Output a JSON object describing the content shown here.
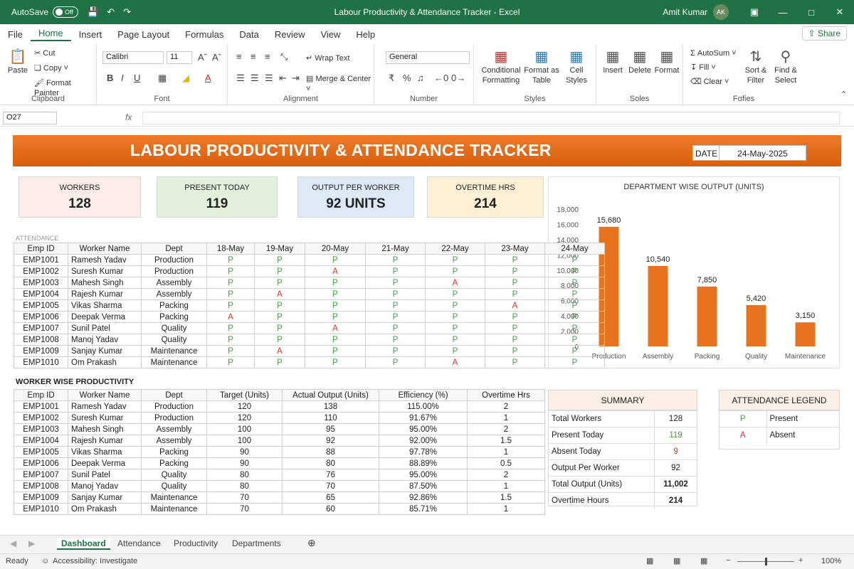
{
  "titlebar": {
    "autosave_label": "AutoSave",
    "autosave_state": "Off",
    "doc_title": "Labour Productivity & Attendance Tracker  -  Excel",
    "user_name": "Amit Kumar",
    "user_initials": "AK"
  },
  "menu": {
    "tabs": [
      "File",
      "Home",
      "Insert",
      "Page Layout",
      "Formulas",
      "Data",
      "Review",
      "View",
      "Help"
    ],
    "share_label": "Share"
  },
  "ribbon": {
    "clipboard": {
      "paste": "Paste",
      "cut": "Cut",
      "copy": "Copy",
      "format_painter": "Format Painter",
      "label": "Clipboard"
    },
    "font": {
      "name": "Calibri",
      "size": "11",
      "label": "Font"
    },
    "alignment": {
      "wrap": "Wrap Text",
      "merge": "Merge & Center",
      "label": "Alignment"
    },
    "number": {
      "format": "General",
      "label": "Number"
    },
    "styles": {
      "conditional": "Conditional Formatting",
      "format_table": "Format as Table",
      "cell_styles": "Cell Styles",
      "label": "Styles"
    },
    "cells": {
      "insert": "Insert",
      "delete": "Delete",
      "format": "Format",
      "label": "Ѕоlеs"
    },
    "editing": {
      "autosum": "AutoSum",
      "fill": "Fill",
      "clear": "Clear",
      "sort": "Sort & Filter",
      "find": "Find & Select",
      "label": "Fαfίes"
    }
  },
  "formula_bar": {
    "name_box": "O27",
    "fx": "fx"
  },
  "dashboard": {
    "title": "LABOUR PRODUCTIVITY & ATTENDANCE TRACKER",
    "date_label": "DATE",
    "date_value": "24-May-2025",
    "kpis": [
      {
        "label": "WORKERS",
        "value": "128",
        "bg": "#fbece7"
      },
      {
        "label": "PRESENT TODAY",
        "value": "119",
        "bg": "#e3f1db"
      },
      {
        "label": "OUTPUT PER WORKER",
        "value": "92 UNITS",
        "bg": "#dde9f5"
      },
      {
        "label": "OVERTIME HRS",
        "value": "214",
        "bg": "#fdf0d5"
      }
    ]
  },
  "attendance": {
    "section_label": "ATTENDANCE",
    "headers": [
      "Emp ID",
      "Worker Name",
      "Dept",
      "18-May",
      "19-May",
      "20-May",
      "21-May",
      "22-May",
      "23-May",
      "24-May"
    ],
    "rows": [
      [
        "EMP1001",
        "Ramesh Yadav",
        "Production",
        "P",
        "P",
        "P",
        "P",
        "P",
        "P",
        "P"
      ],
      [
        "EMP1002",
        "Suresh Kumar",
        "Production",
        "P",
        "P",
        "A",
        "P",
        "P",
        "P",
        "P"
      ],
      [
        "EMP1003",
        "Mahesh Singh",
        "Assembly",
        "P",
        "P",
        "P",
        "P",
        "A",
        "P",
        "P"
      ],
      [
        "EMP1004",
        "Rajesh Kumar",
        "Assembly",
        "P",
        "A",
        "P",
        "P",
        "P",
        "P",
        "P"
      ],
      [
        "EMP1005",
        "Vikas Sharma",
        "Packing",
        "P",
        "P",
        "P",
        "P",
        "P",
        "A",
        "P"
      ],
      [
        "EMP1006",
        "Deepak Verma",
        "Packing",
        "A",
        "P",
        "P",
        "P",
        "P",
        "P",
        "P"
      ],
      [
        "EMP1007",
        "Sunil Patel",
        "Quality",
        "P",
        "P",
        "A",
        "P",
        "P",
        "P",
        "P"
      ],
      [
        "EMP1008",
        "Manoj Yadav",
        "Quality",
        "P",
        "P",
        "P",
        "P",
        "P",
        "P",
        "P"
      ],
      [
        "EMP1009",
        "Sanjay Kumar",
        "Maintenance",
        "P",
        "A",
        "P",
        "P",
        "P",
        "P",
        "P"
      ],
      [
        "EMP1010",
        "Om Prakash",
        "Maintenance",
        "P",
        "P",
        "P",
        "P",
        "A",
        "P",
        "P"
      ]
    ]
  },
  "productivity": {
    "section_label": "WORKER WISE PRODUCTIVITY",
    "headers": [
      "Emp ID",
      "Worker Name",
      "Dept",
      "Target (Units)",
      "Actual Output (Units)",
      "Efficiency (%)",
      "Overtime Hrs"
    ],
    "rows": [
      [
        "EMP1001",
        "Ramesh Yadav",
        "Production",
        "120",
        "138",
        "115.00%",
        "2"
      ],
      [
        "EMP1002",
        "Suresh Kumar",
        "Production",
        "120",
        "110",
        "91.67%",
        "1"
      ],
      [
        "EMP1003",
        "Mahesh Singh",
        "Assembly",
        "100",
        "95",
        "95.00%",
        "2"
      ],
      [
        "EMP1004",
        "Rajesh Kumar",
        "Assembly",
        "100",
        "92",
        "92.00%",
        "1.5"
      ],
      [
        "EMP1005",
        "Vikas Sharma",
        "Packing",
        "90",
        "88",
        "97.78%",
        "1"
      ],
      [
        "EMP1006",
        "Deepak Verma",
        "Packing",
        "90",
        "80",
        "88.89%",
        "0.5"
      ],
      [
        "EMP1007",
        "Sunil Patel",
        "Quality",
        "80",
        "76",
        "95.00%",
        "2"
      ],
      [
        "EMP1008",
        "Manoj Yadav",
        "Quality",
        "80",
        "70",
        "87.50%",
        "1"
      ],
      [
        "EMP1009",
        "Sanjay Kumar",
        "Maintenance",
        "70",
        "65",
        "92.86%",
        "1.5"
      ],
      [
        "EMP1010",
        "Om Prakash",
        "Maintenance",
        "70",
        "60",
        "85.71%",
        "1"
      ]
    ]
  },
  "summary": {
    "title": "SUMMARY",
    "rows": [
      {
        "label": "Total Workers",
        "value": "128",
        "style": ""
      },
      {
        "label": "Present Today",
        "value": "119",
        "style": "green"
      },
      {
        "label": "Absent Today",
        "value": "9",
        "style": "red"
      },
      {
        "label": "Output Per Worker",
        "value": "92",
        "style": ""
      },
      {
        "label": "Total Output (Units)",
        "value": "11,002",
        "style": "bold"
      },
      {
        "label": "Overtime Hours",
        "value": "214",
        "style": "bold"
      }
    ]
  },
  "legend": {
    "title": "ATTENDANCE LEGEND",
    "rows": [
      {
        "code": "P",
        "label": "Present"
      },
      {
        "code": "A",
        "label": "Absent"
      }
    ]
  },
  "chart_data": {
    "type": "bar",
    "title": "DEPARTMENT WISE OUTPUT (UNITS)",
    "categories": [
      "Production",
      "Assembly",
      "Packing",
      "Quality",
      "Maintenance"
    ],
    "values": [
      15680,
      10540,
      7850,
      5420,
      3150
    ],
    "data_labels": [
      "15,680",
      "10,540",
      "7,850",
      "5,420",
      "3,150"
    ],
    "ylim": [
      0,
      18000
    ],
    "yticks": [
      "0",
      "2,000",
      "4,000",
      "6,000",
      "8,000",
      "10,000",
      "12,000",
      "14,000",
      "16,000",
      "18,000"
    ],
    "bar_color": "#e8731e",
    "grid": false
  },
  "sheet_tabs": [
    "Dashboard",
    "Attendance",
    "Productivity",
    "Departments"
  ],
  "status": {
    "ready": "Ready",
    "accessibility": "Accessibility: Investigate",
    "zoom": "100%"
  },
  "colors": {
    "excel_green": "#1f7244",
    "present": "#3aa635",
    "absent": "#e22d2d",
    "banner": "#e8731e"
  }
}
